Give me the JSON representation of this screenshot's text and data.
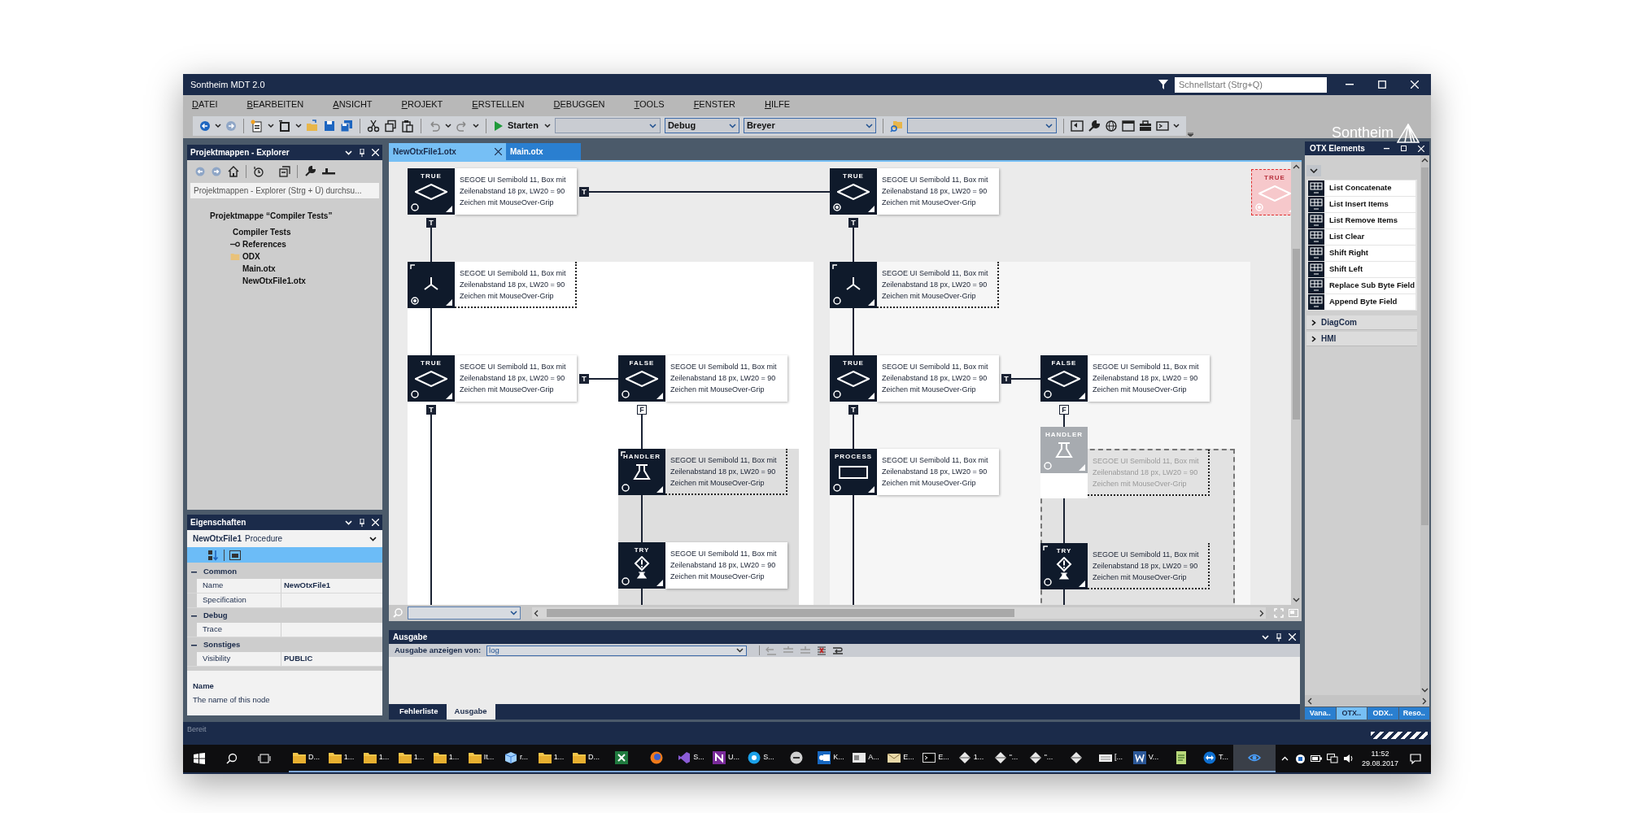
{
  "window": {
    "title": "Sontheim MDT 2.0",
    "quick_launch": {
      "placeholder": "Schnellstart (Strg+Q)"
    },
    "logo": "Sontheim"
  },
  "menu": [
    "DATEI",
    "BEARBEITEN",
    "ANSICHT",
    "PROJEKT",
    "ERSTELLEN",
    "DEBUGGEN",
    "TOOLS",
    "FENSTER",
    "HILFE"
  ],
  "toolbar": {
    "start": "Starten",
    "configuration": "Debug",
    "platform": "Breyer"
  },
  "explorer": {
    "title": "Projektmappen - Explorer",
    "search": {
      "placeholder": "Projektmappen - Explorer (Strg + Ü) durchsu..."
    },
    "tree": [
      {
        "label": "Projektmappe “Compiler Tests”",
        "children": [
          {
            "label": "Compiler Tests",
            "children": [
              {
                "label": "References",
                "kind": "reference"
              },
              {
                "label": "ODX",
                "kind": "folder"
              },
              {
                "label": "Main.otx",
                "kind": "file"
              },
              {
                "label": "NewOtxFile1.otx",
                "kind": "file"
              }
            ]
          }
        ]
      }
    ]
  },
  "properties": {
    "title": "Eigenschaften",
    "object": {
      "name": "NewOtxFile1",
      "type": "Procedure"
    },
    "categories": [
      {
        "name": "Common",
        "expanded": true,
        "rows": [
          {
            "name": "Name",
            "value": "NewOtxFile1"
          },
          {
            "name": "Specification"
          }
        ]
      },
      {
        "name": "Debug",
        "expanded": true,
        "rows": [
          {
            "name": "Trace"
          }
        ]
      },
      {
        "name": "Sonstiges",
        "expanded": true,
        "rows": [
          {
            "name": "Visibility",
            "value": "PUBLIC"
          }
        ]
      }
    ],
    "description": {
      "title": "Name",
      "text": "The name of this node"
    }
  },
  "editor": {
    "tabs": [
      {
        "label": "NewOtxFile1.otx",
        "selected": true
      },
      {
        "label": "Main.otx",
        "selected": false
      }
    ],
    "nodes": [
      {
        "kind": "condition",
        "label": "TRUE",
        "text": "SEGOE UI Semibold 11, Box mit\nZeilenabstand 18 px, LW20 = 90\nZeichen mit MouseOver-Grip",
        "breakpoint": false,
        "outlined": false,
        "marked": false,
        "dimmed": false,
        "preview": false
      },
      {
        "kind": "condition",
        "label": "TRUE",
        "text": "SEGOE UI Semibold 11, Box mit\nZeilenabstand 18 px, LW20 = 90\nZeichen mit MouseOver-Grip",
        "breakpoint": true,
        "outlined": false,
        "marked": false,
        "dimmed": false,
        "preview": false
      },
      {
        "kind": "parallel",
        "text": "SEGOE UI Semibold 11, Box mit\nZeilenabstand 18 px, LW20 = 90\nZeichen mit MouseOver-Grip",
        "breakpoint": true,
        "outlined": true,
        "marked": true,
        "dimmed": false,
        "preview": false
      },
      {
        "kind": "parallel",
        "text": "SEGOE UI Semibold 11, Box mit\nZeilenabstand 18 px, LW20 = 90\nZeichen mit MouseOver-Grip",
        "breakpoint": false,
        "outlined": true,
        "marked": true,
        "dimmed": false,
        "preview": false
      },
      {
        "kind": "condition",
        "label": "TRUE",
        "text": "SEGOE UI Semibold 11, Box mit\nZeilenabstand 18 px, LW20 = 90\nZeichen mit MouseOver-Grip",
        "breakpoint": false,
        "outlined": false,
        "marked": false,
        "dimmed": false,
        "preview": false
      },
      {
        "kind": "condition",
        "label": "FALSE",
        "text": "SEGOE UI Semibold 11, Box mit\nZeilenabstand 18 px, LW20 = 90\nZeichen mit MouseOver-Grip",
        "breakpoint": false,
        "outlined": false,
        "marked": false,
        "dimmed": false,
        "preview": false
      },
      {
        "kind": "condition",
        "label": "TRUE",
        "text": "SEGOE UI Semibold 11, Box mit\nZeilenabstand 18 px, LW20 = 90\nZeichen mit MouseOver-Grip",
        "breakpoint": false,
        "outlined": false,
        "marked": false,
        "dimmed": false,
        "preview": false
      },
      {
        "kind": "condition",
        "label": "FALSE",
        "text": "SEGOE UI Semibold 11, Box mit\nZeilenabstand 18 px, LW20 = 90\nZeichen mit MouseOver-Grip",
        "breakpoint": false,
        "outlined": false,
        "marked": false,
        "dimmed": false,
        "preview": false
      },
      {
        "kind": "handler",
        "label": "HANDLER",
        "text": "SEGOE UI Semibold 11, Box mit\nZeilenabstand 18 px, LW20 = 90\nZeichen mit MouseOver-Grip",
        "breakpoint": false,
        "outlined": true,
        "marked": true,
        "dimmed": false,
        "preview": false
      },
      {
        "kind": "process",
        "label": "PROCESS",
        "text": "SEGOE UI Semibold 11, Box mit\nZeilenabstand 18 px, LW20 = 90\nZeichen mit MouseOver-Grip",
        "breakpoint": false,
        "outlined": false,
        "marked": false,
        "dimmed": false,
        "preview": false
      },
      {
        "kind": "handler",
        "label": "HANDLER",
        "text": "SEGOE UI Semibold 11, Box mit\nZeilenabstand 18 px, LW20 = 90\nZeichen mit MouseOver-Grip",
        "breakpoint": false,
        "outlined": true,
        "marked": false,
        "dimmed": true,
        "preview": false
      },
      {
        "kind": "try",
        "label": "TRY",
        "text": "SEGOE UI Semibold 11, Box mit\nZeilenabstand 18 px, LW20 = 90\nZeichen mit MouseOver-Grip",
        "breakpoint": false,
        "outlined": false,
        "marked": false,
        "dimmed": false,
        "preview": false
      },
      {
        "kind": "try",
        "label": "TRY",
        "text": "SEGOE UI Semibold 11, Box mit\nZeilenabstand 18 px, LW20 = 90\nZeichen mit MouseOver-Grip",
        "breakpoint": false,
        "outlined": true,
        "marked": true,
        "dimmed": false,
        "preview": false
      },
      {
        "kind": "condition",
        "label": "TRUE",
        "breakpoint": true,
        "marked": false,
        "preview": true
      }
    ],
    "connector_labels": [
      {
        "label": "T",
        "kind": "filled"
      },
      {
        "label": "T",
        "kind": "filled"
      },
      {
        "label": "T",
        "kind": "filled"
      },
      {
        "label": "T",
        "kind": "filled"
      },
      {
        "label": "T",
        "kind": "filled"
      },
      {
        "label": "F",
        "kind": "outlined"
      },
      {
        "label": "T",
        "kind": "filled"
      },
      {
        "label": "T",
        "kind": "filled"
      },
      {
        "label": "F",
        "kind": "outlined"
      }
    ]
  },
  "output": {
    "title": "Ausgabe",
    "source_label": "Ausgabe anzeigen von:",
    "source": "log",
    "tabs": [
      {
        "label": "Fehlerliste",
        "selected": false
      },
      {
        "label": "Ausgabe",
        "selected": true
      }
    ]
  },
  "otx_elements": {
    "title": "OTX Elements",
    "items": [
      "List Concatenate",
      "List Insert Items",
      "List Remove Items",
      "List Clear",
      "Shift Right",
      "Shift Left",
      "Replace Sub Byte Field",
      "Append Byte Field"
    ],
    "groups": [
      {
        "label": "DiagCom",
        "expanded": false
      },
      {
        "label": "HMI",
        "expanded": false
      }
    ],
    "tabs": [
      {
        "label": "Vana..",
        "selected": false
      },
      {
        "label": "OTX..",
        "selected": true
      },
      {
        "label": "ODX..",
        "selected": false
      },
      {
        "label": "Reso..",
        "selected": false
      }
    ]
  },
  "status_bar": "Bereit",
  "taskbar": {
    "items": [
      {
        "kind": "folder",
        "label": "D..."
      },
      {
        "kind": "folder",
        "label": "1..."
      },
      {
        "kind": "folder",
        "label": "1..."
      },
      {
        "kind": "folder",
        "label": "1..."
      },
      {
        "kind": "folder",
        "label": "1..."
      },
      {
        "kind": "folder",
        "label": "It..."
      },
      {
        "kind": "cube",
        "label": "r..."
      },
      {
        "kind": "folder",
        "label": "1..."
      },
      {
        "kind": "folder",
        "label": "D..."
      },
      {
        "kind": "excel"
      },
      {
        "kind": "browser"
      },
      {
        "kind": "vs",
        "label": "S..."
      },
      {
        "kind": "onenote",
        "label": "U..."
      },
      {
        "kind": "skype",
        "label": "S..."
      },
      {
        "kind": "chat"
      },
      {
        "kind": "outlook",
        "label": "K..."
      },
      {
        "kind": "app",
        "label": "A..."
      },
      {
        "kind": "mail",
        "label": "E..."
      },
      {
        "kind": "terminal",
        "label": "E..."
      },
      {
        "kind": "diamond",
        "label": "1..."
      },
      {
        "kind": "diamond",
        "label": "\"..."
      },
      {
        "kind": "diamond",
        "label": "\"..."
      },
      {
        "kind": "diamond"
      },
      {
        "kind": "keyboard",
        "label": "[..."
      },
      {
        "kind": "word",
        "label": "V..."
      },
      {
        "kind": "notepad"
      },
      {
        "kind": "teamviewer",
        "label": "T..."
      },
      {
        "kind": "eye"
      }
    ],
    "clock": {
      "time": "11:52",
      "date": "29.08.2017"
    }
  }
}
